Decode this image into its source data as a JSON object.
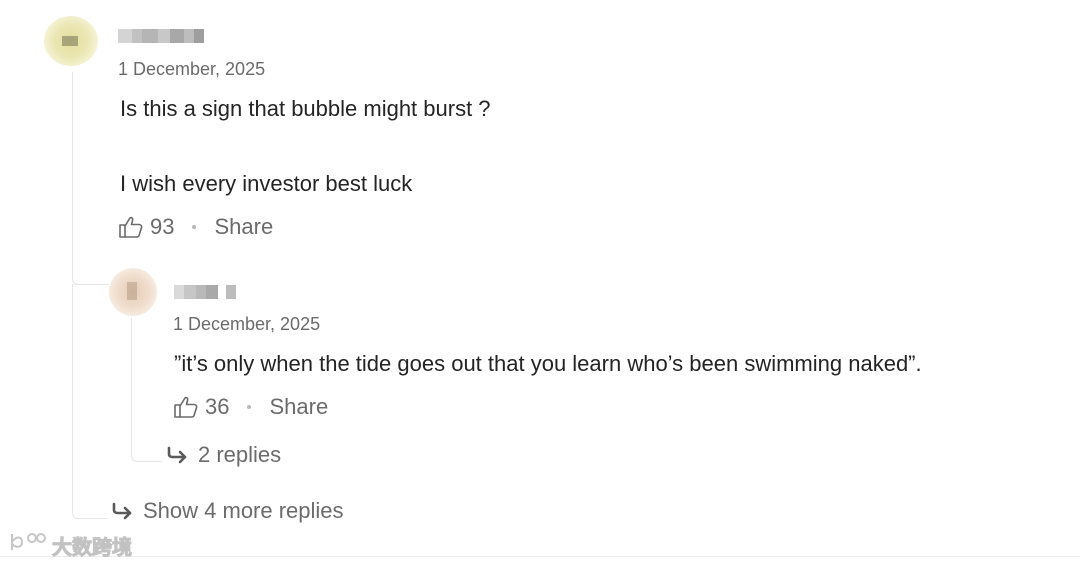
{
  "comment": {
    "date": "1 December, 2025",
    "body_line1": "Is this a sign that bubble might burst ?",
    "body_line2": "I wish every investor best luck",
    "clap_count": "93",
    "share_label": "Share"
  },
  "reply": {
    "date": "1 December, 2025",
    "body": "”it’s only when the tide goes out that you learn who’s been swimming naked”.",
    "clap_count": "36",
    "share_label": "Share",
    "replies_label": "2 replies"
  },
  "show_more_label": "Show 4 more replies",
  "watermark": {
    "text": "大数跨境"
  },
  "icons": {
    "clap": "clap-icon",
    "reply_arrow": "reply-arrow-icon"
  },
  "colors": {
    "text_primary": "#242424",
    "text_secondary": "#6b6b6b",
    "thread_line": "#e6e6e6"
  }
}
